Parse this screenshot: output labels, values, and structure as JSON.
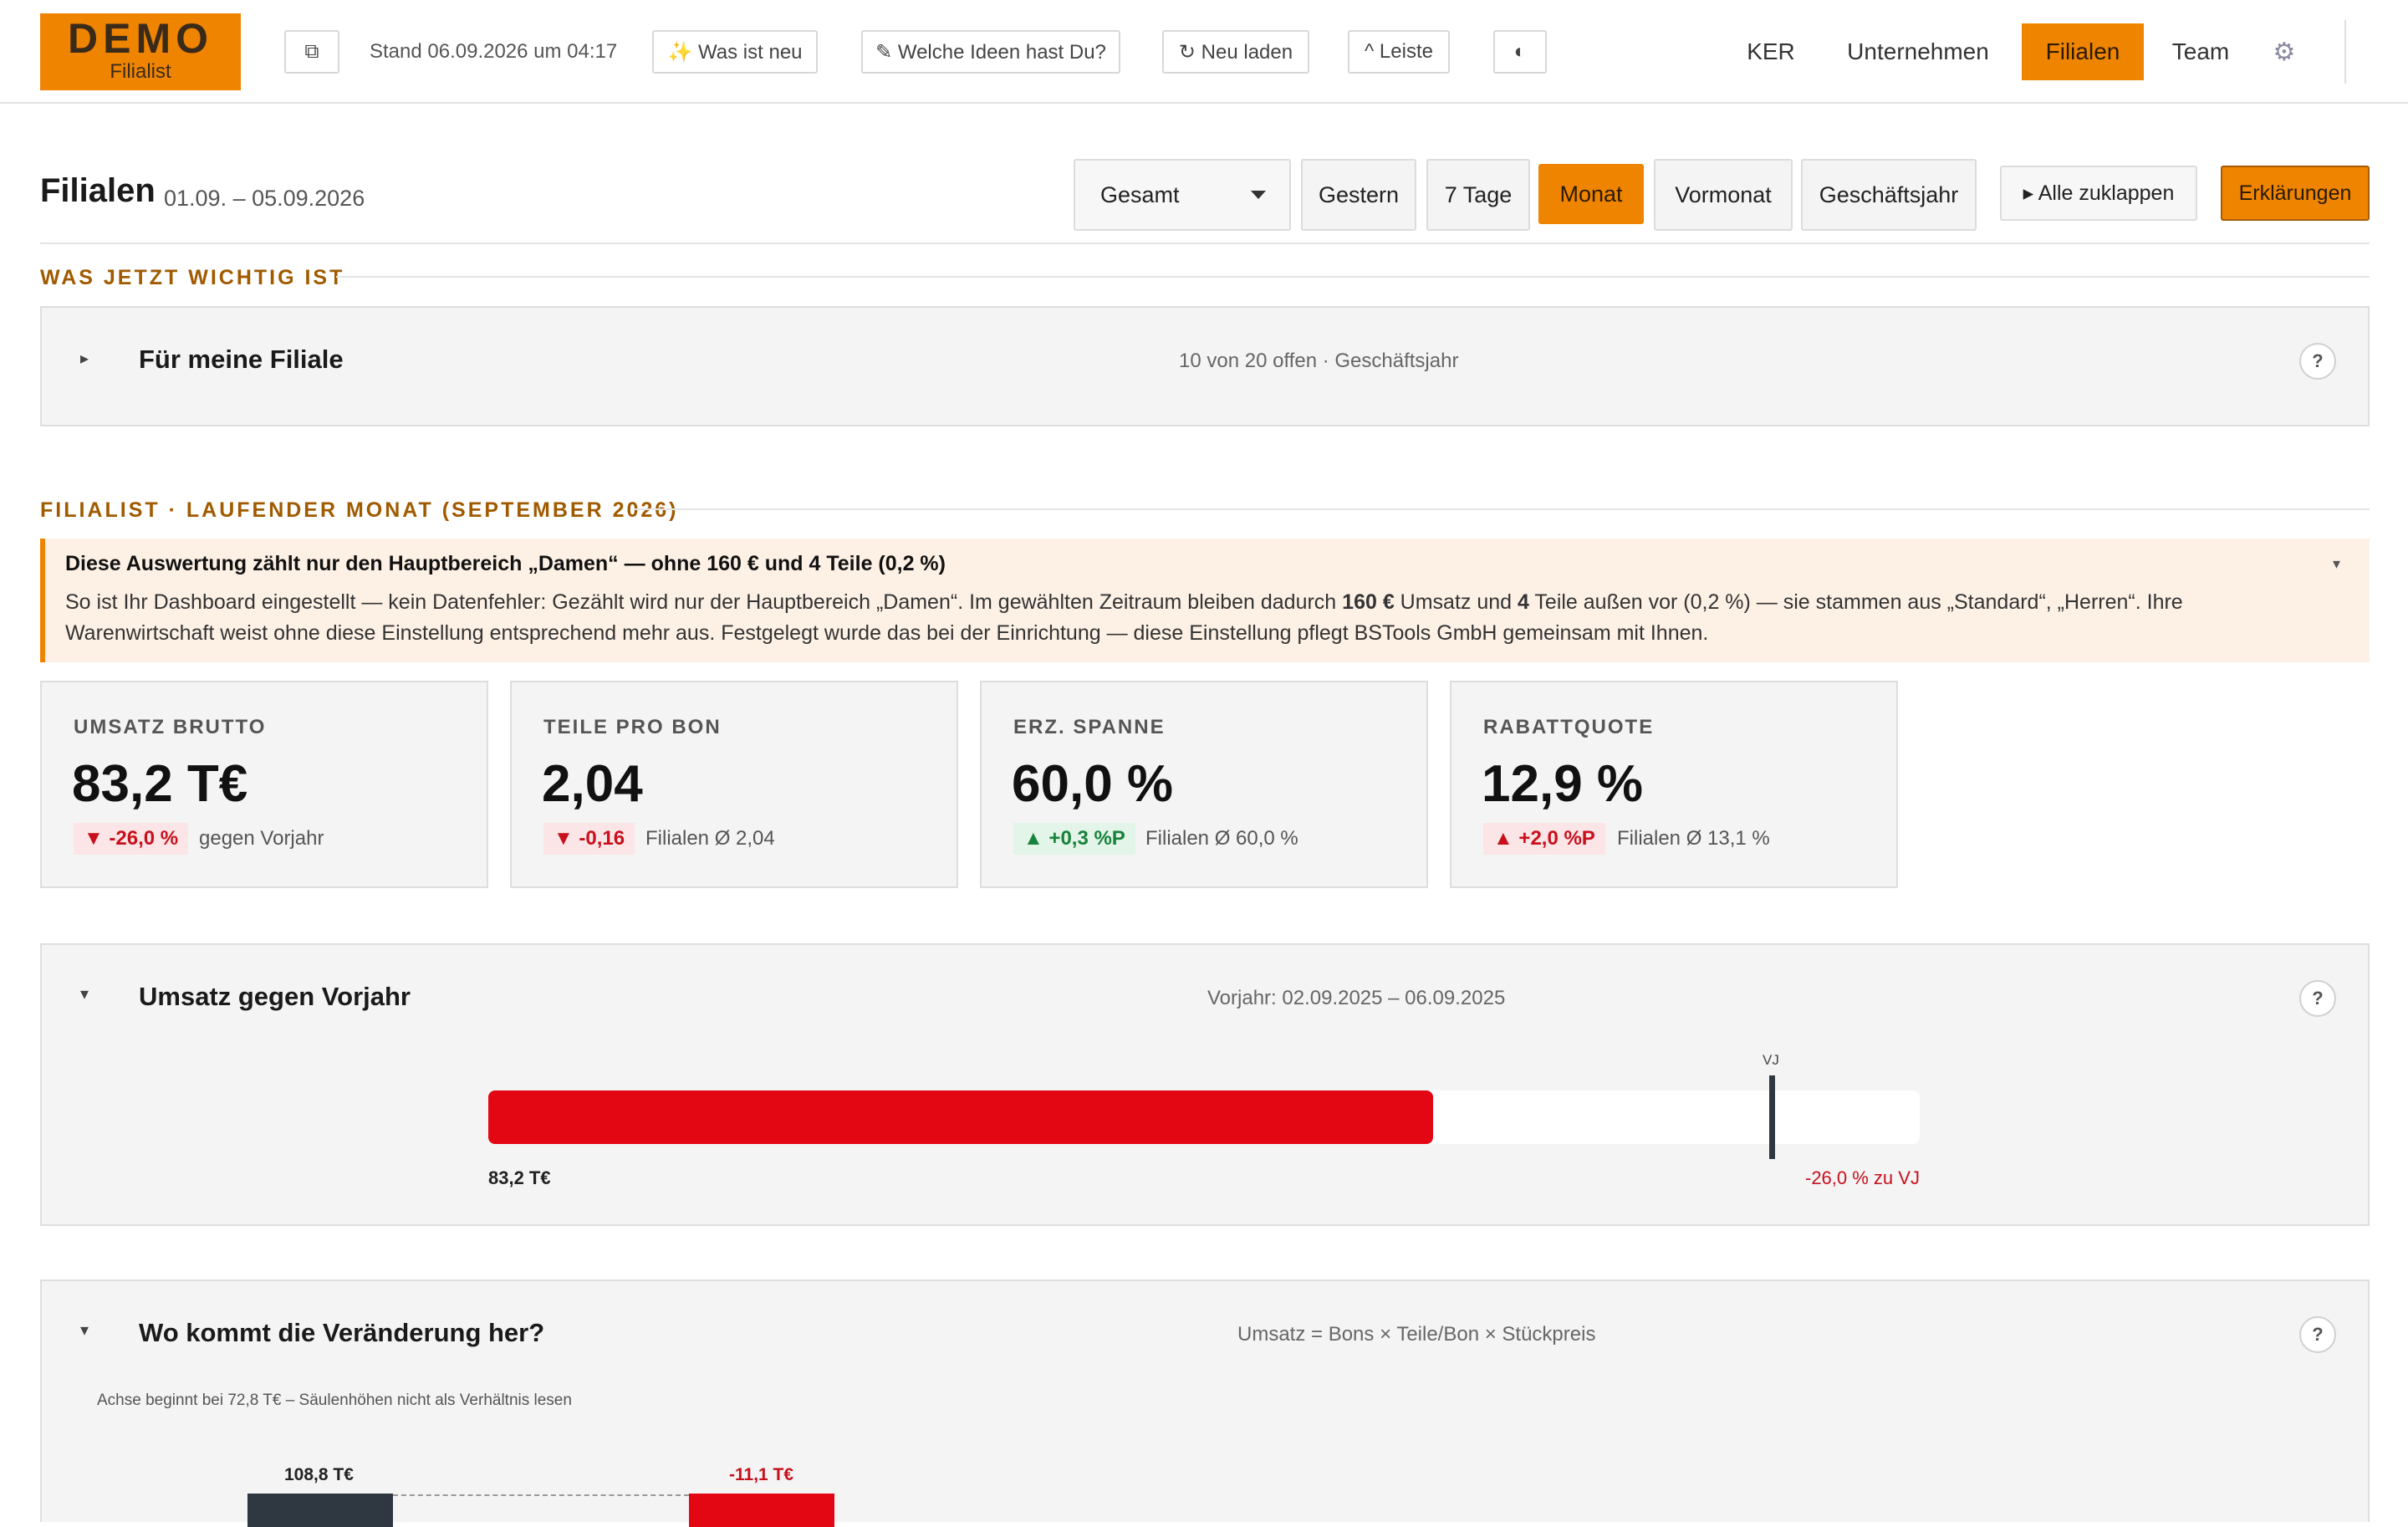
{
  "logo": {
    "line1": "DEMO",
    "line2": "Filialist"
  },
  "topbar": {
    "copy_icon": "⧉",
    "stand": "Stand 06.09.2026 um 04:17",
    "whats_new": "✨ Was ist neu",
    "ideas": "✎ Welche Ideen hast Du?",
    "reload": "↻ Neu laden",
    "leiste": "^ Leiste",
    "theme_icon": "◐",
    "nav": [
      "KER",
      "Unternehmen",
      "Filialen",
      "Team"
    ],
    "active_nav": "Filialen",
    "settings_icon": "⚙"
  },
  "header": {
    "title": "Filialen",
    "range": "01.09. – 05.09.2026",
    "scope_select": "Gesamt",
    "periods": [
      "Gestern",
      "7 Tage",
      "Monat",
      "Vormonat",
      "Geschäftsjahr"
    ],
    "active_period": "Monat",
    "collapse_all": "▸  Alle zuklappen",
    "explanations": "Erklärungen"
  },
  "section_important": {
    "heading": "WAS JETZT WICHTIG IST",
    "panel": {
      "toggle": "▸",
      "title": "Für meine Filiale",
      "meta": "10 von 20 offen · Geschäftsjahr",
      "help": "?"
    }
  },
  "section_month": {
    "heading": "FILIALIST · LAUFENDER MONAT (SEPTEMBER 2026)"
  },
  "notice": {
    "headline": "Diese Auswertung zählt nur den Hauptbereich „Damen“ — ohne 160 € und 4 Teile (0,2 %)",
    "body_1": "So ist Ihr Dashboard eingestellt — kein Datenfehler: Gezählt wird nur der Hauptbereich „Damen“. Im gewählten Zeitraum bleiben dadurch ",
    "amount": "160 €",
    "body_2": " Umsatz und ",
    "parts": "4",
    "body_3": " Teile außen vor (0,2 %) — sie stammen aus „Standard“, „Herren“. Ihre Warenwirtschaft weist ohne diese Einstellung entsprechend mehr aus. Festgelegt wurde das bei der Einrichtung — diese Einstellung pflegt BSTools GmbH gemeinsam mit Ihnen.",
    "toggle": "▾"
  },
  "kpis": [
    {
      "label": "UMSATZ BRUTTO",
      "value": "83,2 T€",
      "delta": "▼ -26,0 %",
      "trend": "neg",
      "ref": "gegen Vorjahr"
    },
    {
      "label": "TEILE PRO BON",
      "value": "2,04",
      "delta": "▼ -0,16",
      "trend": "neg",
      "ref": "Filialen Ø 2,04"
    },
    {
      "label": "ERZ. SPANNE",
      "value": "60,0 %",
      "delta": "▲ +0,3 %P",
      "trend": "pos",
      "ref": "Filialen Ø 60,0 %"
    },
    {
      "label": "RABATTQUOTE",
      "value": "12,9 %",
      "delta": "▲ +2,0 %P",
      "trend": "neg",
      "ref": "Filialen Ø 13,1 %"
    }
  ],
  "revenue_vs_ly": {
    "toggle": "▾",
    "title": "Umsatz gegen Vorjahr",
    "meta": "Vorjahr: 02.09.2025 – 06.09.2025",
    "help": "?",
    "bar": {
      "current_label": "83,2 T€",
      "current_fraction": 0.66,
      "marker_label": "VJ",
      "marker_fraction": 0.895,
      "delta_label": "-26,0 % zu VJ",
      "bar_color": "#e30613"
    }
  },
  "change_source": {
    "toggle": "▾",
    "title": "Wo kommt die Veränderung her?",
    "meta": "Umsatz = Bons × Teile/Bon × Stückpreis",
    "help": "?",
    "axis_note": "Achse beginnt bei 72,8 T€ – Säulenhöhen nicht als Verhältnis lesen",
    "bars": [
      {
        "label": "108,8 T€",
        "color": "#2f3840"
      },
      {
        "label": "-11,1 T€",
        "color": "#e30613"
      }
    ]
  },
  "colors": {
    "accent": "#ef8400",
    "negative": "#c8101c",
    "positive": "#17823a",
    "heading": "#a05a00"
  }
}
